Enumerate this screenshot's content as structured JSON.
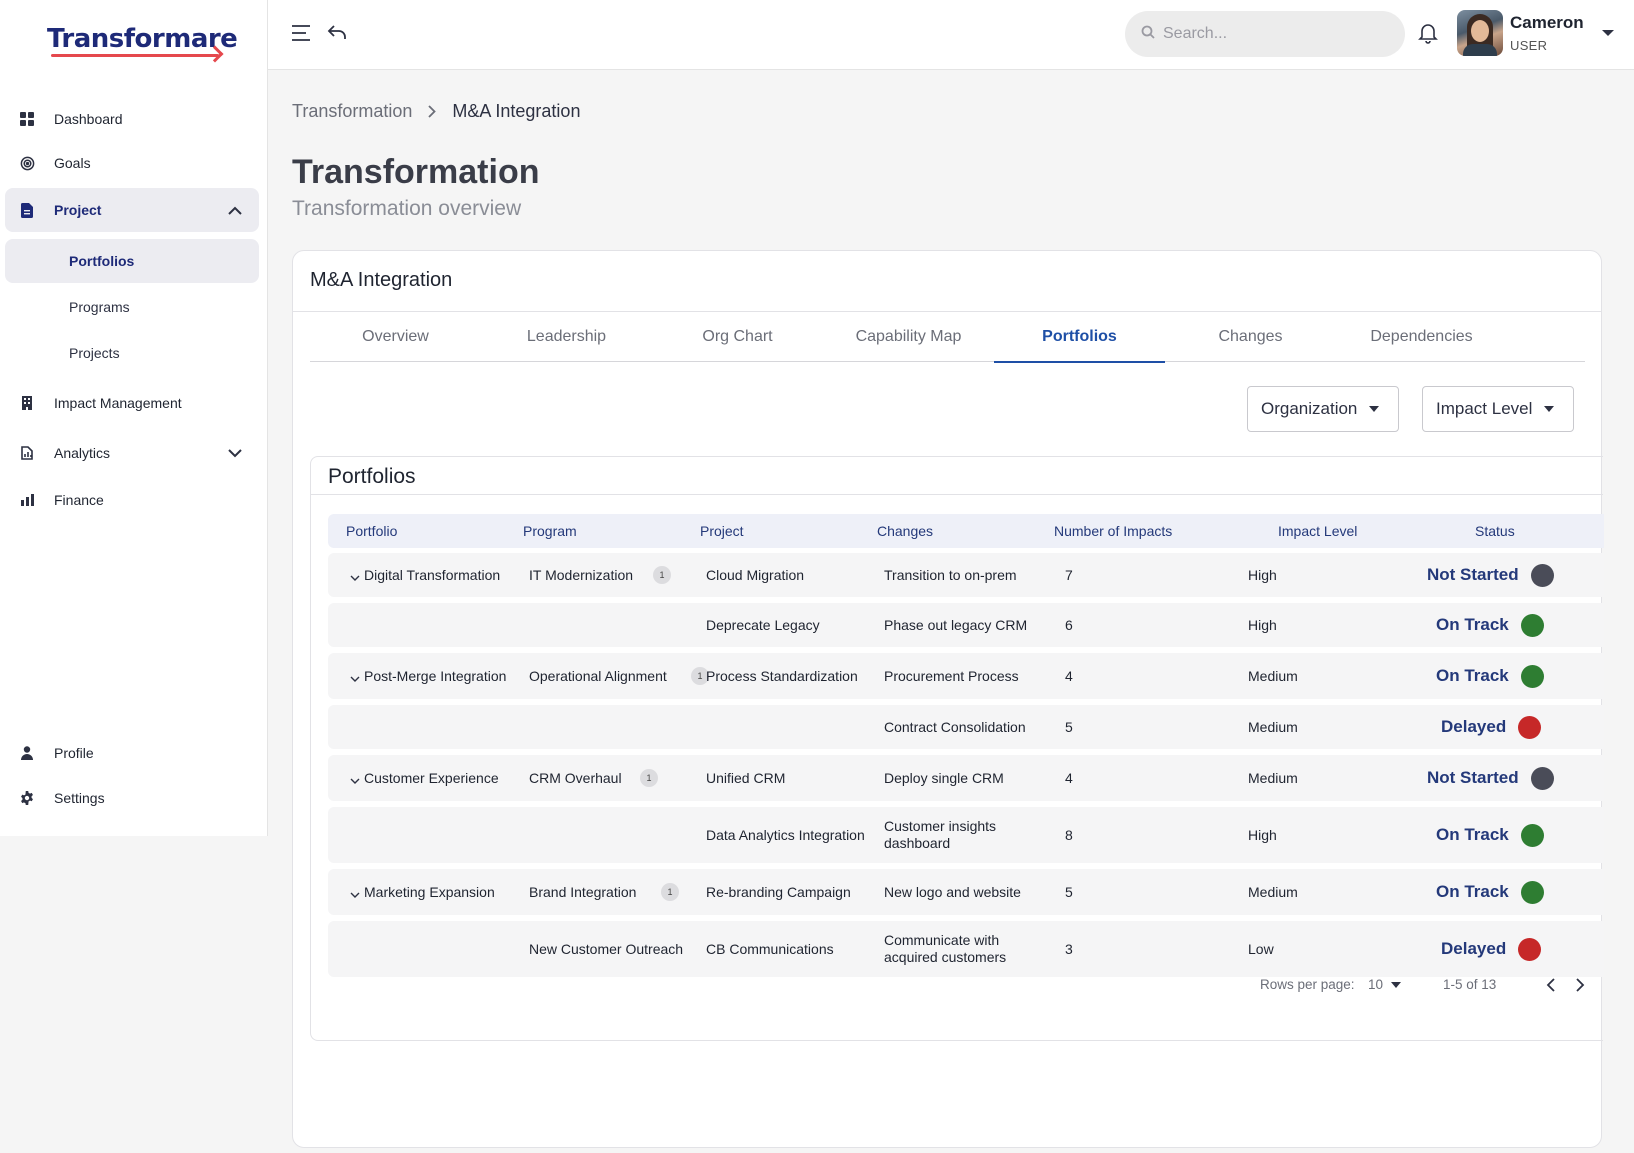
{
  "brand": {
    "name": "Transformare"
  },
  "sidebar": {
    "items": [
      {
        "label": "Dashboard",
        "icon": "grid-icon"
      },
      {
        "label": "Goals",
        "icon": "target-icon"
      },
      {
        "label": "Project",
        "icon": "document-icon",
        "expanded": true
      },
      {
        "label": "Impact Management",
        "icon": "building-icon"
      },
      {
        "label": "Analytics",
        "icon": "analytics-icon",
        "expanded": false
      },
      {
        "label": "Finance",
        "icon": "bar-chart-icon"
      }
    ],
    "project_subitems": [
      {
        "label": "Portfolios",
        "active": true
      },
      {
        "label": "Programs"
      },
      {
        "label": "Projects"
      }
    ],
    "bottom_items": [
      {
        "label": "Profile",
        "icon": "person-icon"
      },
      {
        "label": "Settings",
        "icon": "gear-icon"
      }
    ]
  },
  "topbar": {
    "search_placeholder": "Search...",
    "user": {
      "name": "Cameron",
      "role": "USER"
    }
  },
  "breadcrumb": [
    "Transformation",
    "M&A Integration"
  ],
  "page": {
    "title": "Transformation",
    "subtitle": "Transformation overview"
  },
  "card": {
    "title": "M&A Integration",
    "tabs": [
      "Overview",
      "Leadership",
      "Org Chart",
      "Capability Map",
      "Portfolios",
      "Changes",
      "Dependencies"
    ],
    "active_tab": "Portfolios",
    "filters": [
      "Organization",
      "Impact Level"
    ]
  },
  "table": {
    "title": "Portfolios",
    "columns": [
      "Portfolio",
      "Program",
      "Project",
      "Changes",
      "Number of Impacts",
      "Impact Level",
      "Status"
    ],
    "rows": [
      {
        "portfolio": "Digital Transformation",
        "program": "IT Modernization",
        "badge": "1",
        "project": "Cloud Migration",
        "change": "Transition to on-prem",
        "impacts": "7",
        "level": "High",
        "status": "Not Started"
      },
      {
        "portfolio": "",
        "program": "",
        "badge": "",
        "project": "Deprecate Legacy",
        "change": "Phase out legacy CRM",
        "impacts": "6",
        "level": "High",
        "status": "On Track"
      },
      {
        "portfolio": "Post-Merge Integration",
        "program": "Operational Alignment",
        "badge": "1",
        "project": "Process Standardization",
        "change": "Procurement Process",
        "impacts": "4",
        "level": "Medium",
        "status": "On Track"
      },
      {
        "portfolio": "",
        "program": "",
        "badge": "",
        "project": "",
        "change": "Contract Consolidation",
        "impacts": "5",
        "level": "Medium",
        "status": "Delayed"
      },
      {
        "portfolio": "Customer Experience",
        "program": "CRM Overhaul",
        "badge": "1",
        "project": "Unified CRM",
        "change": "Deploy single CRM",
        "impacts": "4",
        "level": "Medium",
        "status": "Not Started"
      },
      {
        "portfolio": "",
        "program": "",
        "badge": "",
        "project": "Data Analytics Integration",
        "change": "Customer insights dashboard",
        "impacts": "8",
        "level": "High",
        "status": "On Track"
      },
      {
        "portfolio": "Marketing Expansion",
        "program": "Brand Integration",
        "badge": "1",
        "project": "Re-branding Campaign",
        "change": "New logo and website",
        "impacts": "5",
        "level": "Medium",
        "status": "On Track"
      },
      {
        "portfolio": "",
        "program": "New Customer Outreach",
        "badge": "",
        "project": "CB Communications",
        "change": "Communicate with acquired customers",
        "impacts": "3",
        "level": "Low",
        "status": "Delayed"
      }
    ],
    "status_colors": {
      "Not Started": "#4a4c58",
      "On Track": "#2e7d32",
      "Delayed": "#c62828"
    },
    "pagination": {
      "rows_per_page_label": "Rows per page:",
      "rows_per_page": "10",
      "range": "1-5 of 13"
    }
  }
}
